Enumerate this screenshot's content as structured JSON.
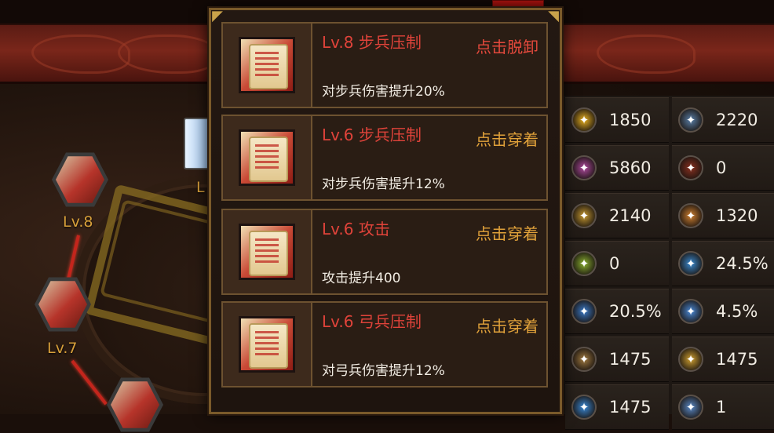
{
  "skill_tree": {
    "nodes": [
      {
        "label": "Lv.8"
      },
      {
        "label": "Lv.7"
      }
    ],
    "partial_label": "L"
  },
  "popup": {
    "items": [
      {
        "name": "Lv.8 步兵压制",
        "action": "点击脱卸",
        "action_type": "unequip",
        "description": "对步兵伤害提升20%"
      },
      {
        "name": "Lv.6 步兵压制",
        "action": "点击穿着",
        "action_type": "equip",
        "description": "对步兵伤害提升12%"
      },
      {
        "name": "Lv.6 攻击",
        "action": "点击穿着",
        "action_type": "equip",
        "description": "攻击提升400"
      },
      {
        "name": "Lv.6 弓兵压制",
        "action": "点击穿着",
        "action_type": "equip",
        "description": "对弓兵伤害提升12%"
      }
    ]
  },
  "stats": [
    [
      {
        "icon": "sword-slash-icon",
        "color": "#e8b020",
        "value": "1850"
      },
      {
        "icon": "shield-icon",
        "color": "#5a7fa8",
        "value": "2220"
      }
    ],
    [
      {
        "icon": "magic-burst-icon",
        "color": "#b04aa0",
        "value": "5860"
      },
      {
        "icon": "warrior-icon",
        "color": "#8a3020",
        "value": "0"
      }
    ],
    [
      {
        "icon": "strike-icon",
        "color": "#c89a30",
        "value": "2140"
      },
      {
        "icon": "fist-icon",
        "color": "#d08030",
        "value": "1320"
      }
    ],
    [
      {
        "icon": "poison-icon",
        "color": "#8ab030",
        "value": "0"
      },
      {
        "icon": "dodge-icon",
        "color": "#3a8ad0",
        "value": "24.5%"
      }
    ],
    [
      {
        "icon": "critical-icon",
        "color": "#3a7ac8",
        "value": "20.5%"
      },
      {
        "icon": "pierce-icon",
        "color": "#4a8ad8",
        "value": "4.5%"
      }
    ],
    [
      {
        "icon": "beast-icon",
        "color": "#a07a40",
        "value": "1475"
      },
      {
        "icon": "burst-icon",
        "color": "#d0a030",
        "value": "1475"
      }
    ],
    [
      {
        "icon": "wave-icon",
        "color": "#3a8ad8",
        "value": "1475"
      },
      {
        "icon": "orb-icon",
        "color": "#5a8ac8",
        "value": "1"
      }
    ]
  ]
}
